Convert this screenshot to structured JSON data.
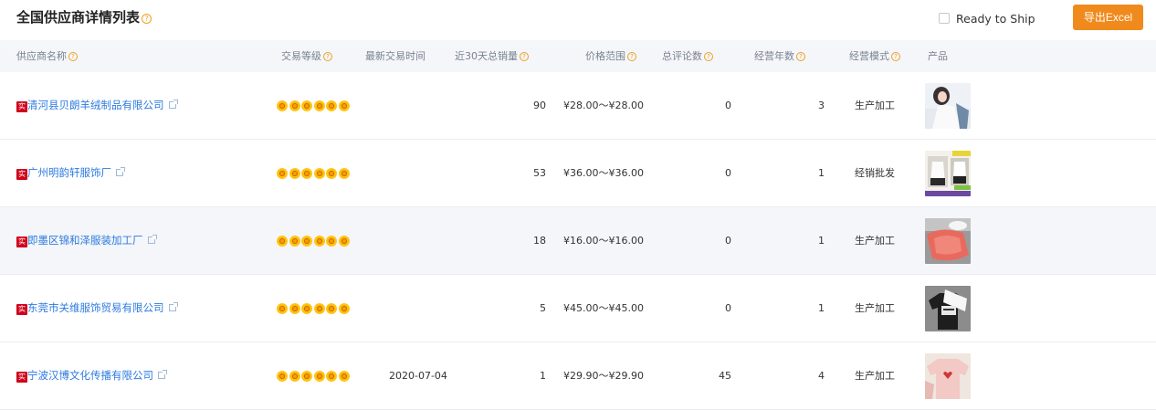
{
  "header": {
    "title": "全国供应商详情列表",
    "ready_to_ship_label": "Ready to Ship",
    "export_label": "导出Excel"
  },
  "columns": {
    "supplier": "供应商名称",
    "trade_level": "交易等级",
    "latest_trade": "最新交易时间",
    "sales_30d": "近30天总销量",
    "price_range": "价格范围",
    "reviews": "总评论数",
    "years": "经营年数",
    "mode": "经营模式",
    "product": "产品"
  },
  "badge_label": "实",
  "rows": [
    {
      "supplier": "清河县贝朗羊绒制品有限公司",
      "latest_trade": "",
      "sales_30d": "90",
      "price": "¥28.00～¥28.00",
      "reviews": "0",
      "years": "3",
      "mode": "生产加工",
      "stars": 6
    },
    {
      "supplier": "广州明韵轩服饰厂",
      "latest_trade": "",
      "sales_30d": "53",
      "price": "¥36.00～¥36.00",
      "reviews": "0",
      "years": "1",
      "mode": "经销批发",
      "stars": 6
    },
    {
      "supplier": "即墨区锦和泽服装加工厂",
      "latest_trade": "",
      "sales_30d": "18",
      "price": "¥16.00～¥16.00",
      "reviews": "0",
      "years": "1",
      "mode": "生产加工",
      "stars": 6
    },
    {
      "supplier": "东莞市关维服饰贸易有限公司",
      "latest_trade": "",
      "sales_30d": "5",
      "price": "¥45.00～¥45.00",
      "reviews": "0",
      "years": "1",
      "mode": "生产加工",
      "stars": 6
    },
    {
      "supplier": "宁波汉博文化传播有限公司",
      "latest_trade": "2020-07-04",
      "sales_30d": "1",
      "price": "¥29.90～¥29.90",
      "reviews": "45",
      "years": "4",
      "mode": "生产加工",
      "stars": 6
    }
  ],
  "colors": {
    "accent": "#f08a1c",
    "link": "#2d7ae0",
    "badge": "#d0021b",
    "header_bg": "#f4f6f9"
  }
}
